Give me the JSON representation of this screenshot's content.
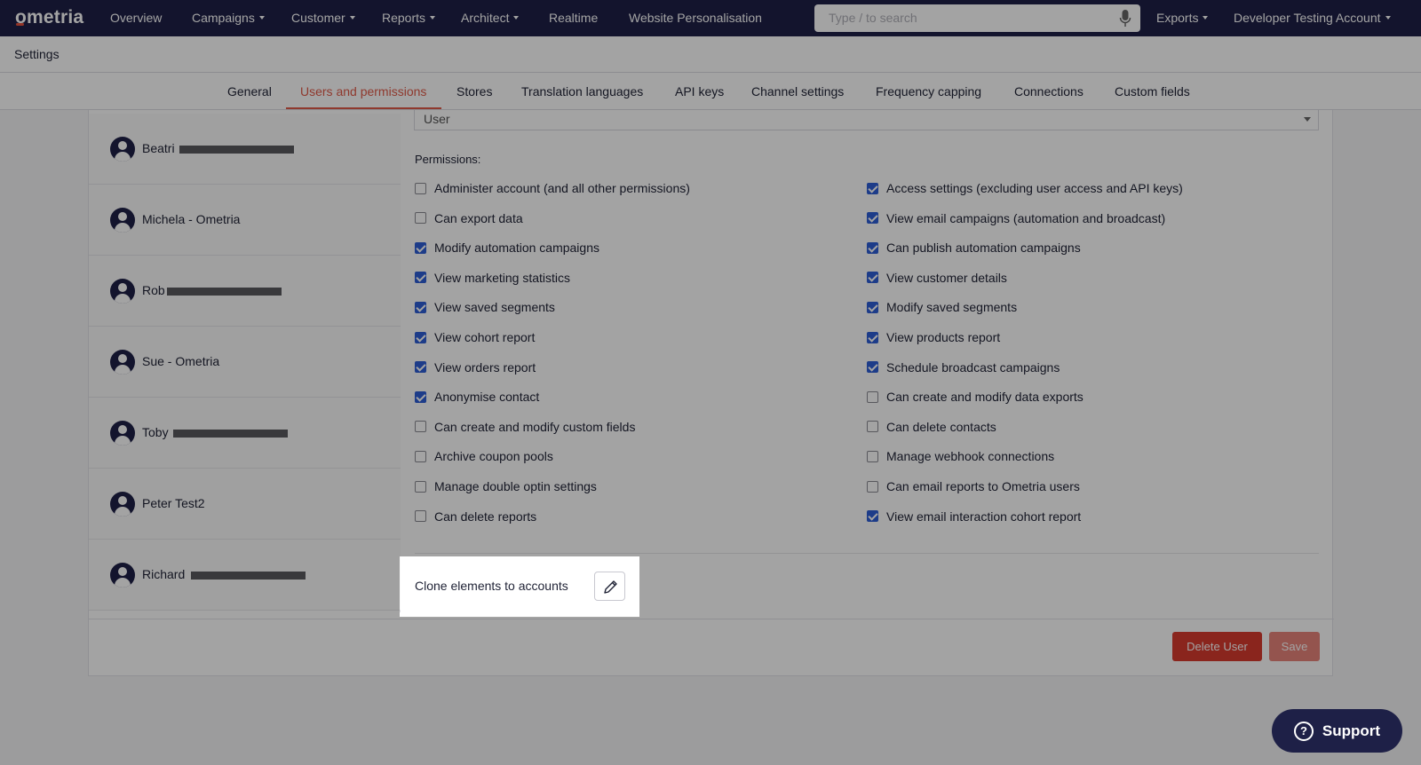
{
  "nav": {
    "logo": "ometria",
    "items": [
      {
        "label": "Overview",
        "dropdown": false
      },
      {
        "label": "Campaigns",
        "dropdown": true
      },
      {
        "label": "Customer",
        "dropdown": true
      },
      {
        "label": "Reports",
        "dropdown": true
      },
      {
        "label": "Architect",
        "dropdown": true
      },
      {
        "label": "Realtime",
        "dropdown": false
      },
      {
        "label": "Website Personalisation",
        "dropdown": false
      }
    ],
    "search_placeholder": "Type / to search",
    "exports": "Exports",
    "account": "Developer Testing Account"
  },
  "settings": {
    "title": "Settings",
    "tabs": [
      "General",
      "Users and permissions",
      "Stores",
      "Translation languages",
      "API keys",
      "Channel settings",
      "Frequency capping",
      "Connections",
      "Custom fields"
    ],
    "active_tab": "Users and permissions"
  },
  "users": [
    {
      "name": "Beatri",
      "redacted": true
    },
    {
      "name": "Michela - Ometria",
      "redacted": false
    },
    {
      "name": "Rob",
      "redacted": true
    },
    {
      "name": "Sue - Ometria",
      "redacted": false
    },
    {
      "name": "Toby",
      "redacted": true
    },
    {
      "name": "Peter Test2",
      "redacted": false
    },
    {
      "name": "Richard",
      "redacted": true
    }
  ],
  "role": {
    "value": "User"
  },
  "permissions": {
    "title": "Permissions:",
    "left": [
      {
        "label": "Administer account (and all other permissions)",
        "checked": false
      },
      {
        "label": "Can export data",
        "checked": false
      },
      {
        "label": "Modify automation campaigns",
        "checked": true
      },
      {
        "label": "View marketing statistics",
        "checked": true
      },
      {
        "label": "View saved segments",
        "checked": true
      },
      {
        "label": "View cohort report",
        "checked": true
      },
      {
        "label": "View orders report",
        "checked": true
      },
      {
        "label": "Anonymise contact",
        "checked": true
      },
      {
        "label": "Can create and modify custom fields",
        "checked": false
      },
      {
        "label": "Archive coupon pools",
        "checked": false
      },
      {
        "label": "Manage double optin settings",
        "checked": false
      },
      {
        "label": "Can delete reports",
        "checked": false
      }
    ],
    "right": [
      {
        "label": "Access settings (excluding user access and API keys)",
        "checked": true
      },
      {
        "label": "View email campaigns (automation and broadcast)",
        "checked": true
      },
      {
        "label": "Can publish automation campaigns",
        "checked": true
      },
      {
        "label": "View customer details",
        "checked": true
      },
      {
        "label": "Modify saved segments",
        "checked": true
      },
      {
        "label": "View products report",
        "checked": true
      },
      {
        "label": "Schedule broadcast campaigns",
        "checked": true
      },
      {
        "label": "Can create and modify data exports",
        "checked": false
      },
      {
        "label": "Can delete contacts",
        "checked": false
      },
      {
        "label": "Manage webhook connections",
        "checked": false
      },
      {
        "label": "Can email reports to Ometria users",
        "checked": false
      },
      {
        "label": "View email interaction cohort report",
        "checked": true
      }
    ]
  },
  "clone": {
    "label": "Clone elements to accounts"
  },
  "actions": {
    "delete": "Delete User",
    "save": "Save"
  },
  "support": {
    "label": "Support"
  },
  "colors": {
    "nav_bg": "#1e2047",
    "accent": "#e05a48",
    "checkbox": "#2e5fd6",
    "delete": "#d83a2e"
  }
}
